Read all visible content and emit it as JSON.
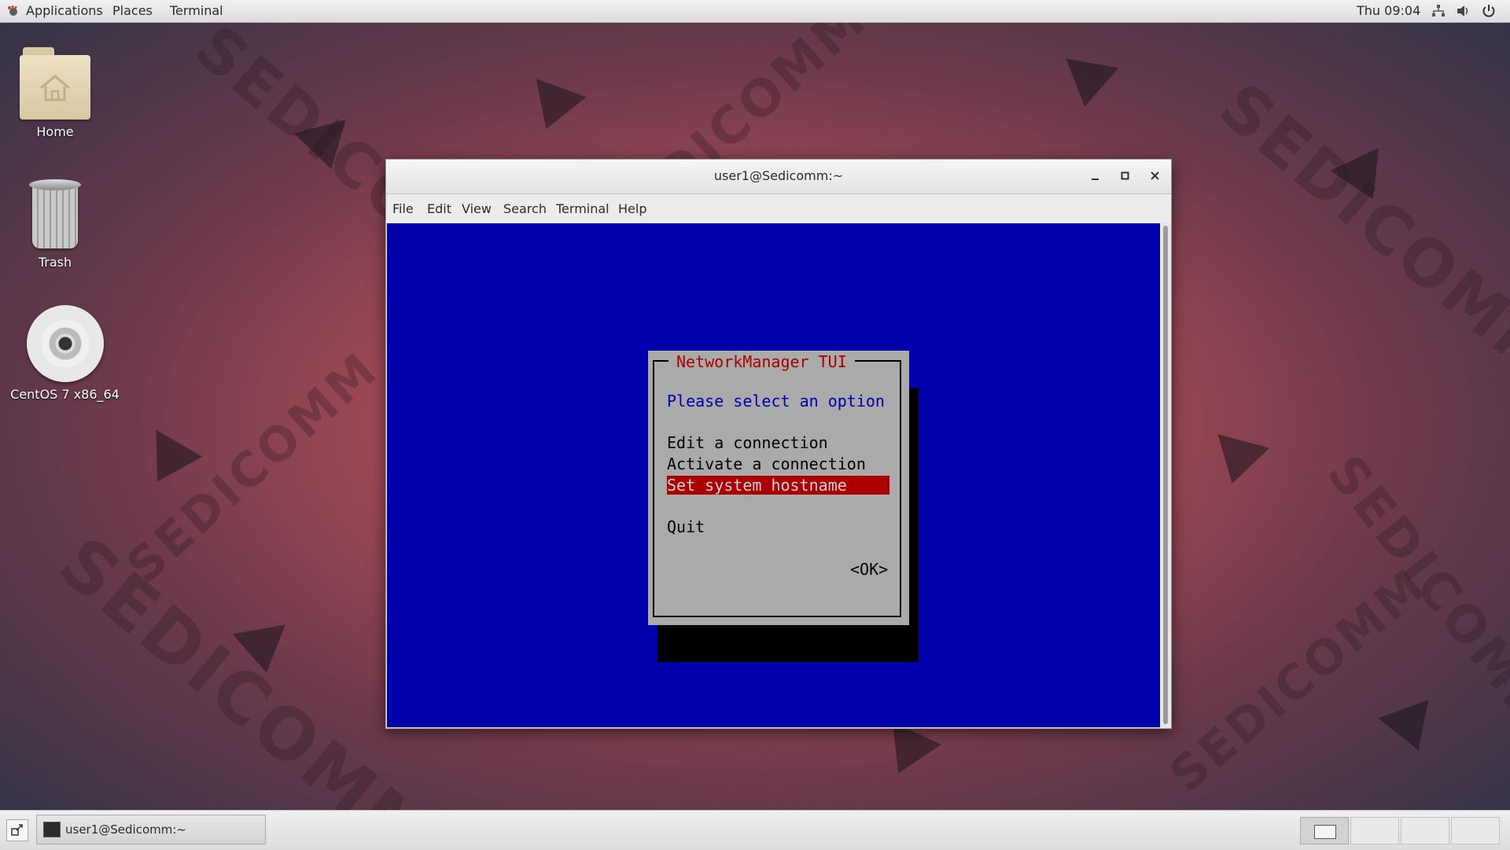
{
  "top_panel": {
    "apps_icon": "gnome-foot-icon",
    "menus": [
      "Applications",
      "Places",
      "Terminal"
    ],
    "clock": "Thu 09:04",
    "status_icons": [
      "network-icon",
      "volume-icon",
      "power-icon"
    ]
  },
  "wallpaper": {
    "brand": "SEDICOMM"
  },
  "desktop": {
    "icons": [
      {
        "label": "Home",
        "icon": "home-folder-icon"
      },
      {
        "label": "Trash",
        "icon": "trash-icon"
      },
      {
        "label": "CentOS 7 x86_64",
        "icon": "optical-disc-icon"
      }
    ]
  },
  "window": {
    "title": "user1@Sedicomm:~",
    "controls": {
      "minimize": "‗",
      "maximize": "▪",
      "close": "✕"
    },
    "menu": [
      "File",
      "Edit",
      "View",
      "Search",
      "Terminal",
      "Help"
    ]
  },
  "tui": {
    "title": "NetworkManager TUI",
    "prompt": "Please select an option",
    "items": [
      "Edit a connection",
      "Activate a connection",
      "Set system hostname",
      "Quit"
    ],
    "selected_index": 2,
    "ok_label": "<OK>"
  },
  "taskbar": {
    "show_desktop_icon": "show-desktop-icon",
    "task_label": "user1@Sedicomm:~",
    "workspaces": 4,
    "active_workspace": 1
  },
  "colors": {
    "terminal_bg": "#0000aa",
    "dialog_bg": "#aaaaaa",
    "dialog_title": "#aa0000",
    "selected_bg": "#aa0000",
    "prompt_text": "#0000aa"
  }
}
